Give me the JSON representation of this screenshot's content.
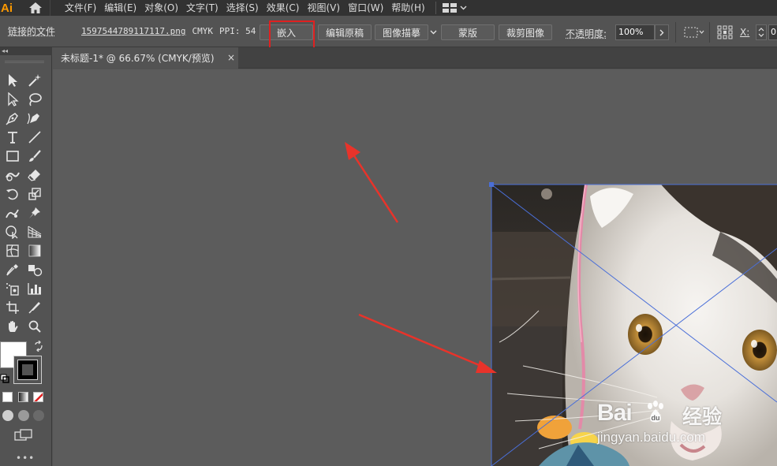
{
  "app": {
    "logo_text": "Ai"
  },
  "menu": {
    "items": [
      "文件(F)",
      "编辑(E)",
      "对象(O)",
      "文字(T)",
      "选择(S)",
      "效果(C)",
      "视图(V)",
      "窗口(W)",
      "帮助(H)"
    ]
  },
  "control_bar": {
    "linked_file_label": "链接的文件",
    "file_name": "1597544789117117.png",
    "color_mode": "CMYK",
    "ppi": "PPI: 54",
    "embed_label": "嵌入",
    "edit_original_label": "编辑原稿",
    "image_trace_label": "图像描摹",
    "mask_label": "蒙版",
    "crop_label": "裁剪图像",
    "opacity_label": "不透明度:",
    "opacity_value": "100%",
    "x_label": "X:",
    "x_value": "0"
  },
  "document": {
    "tab_title": "未标题-1* @ 66.67% (CMYK/预览)",
    "close_glyph": "×"
  },
  "watermark": {
    "brand": "Bai",
    "brand_suffix": "经验",
    "url": "jingyan.baidu.com"
  },
  "colors": {
    "highlight": "#e02020",
    "arrow": "#e8332a",
    "bounding_box": "#4a6fd8",
    "logo": "#ff9a00"
  }
}
